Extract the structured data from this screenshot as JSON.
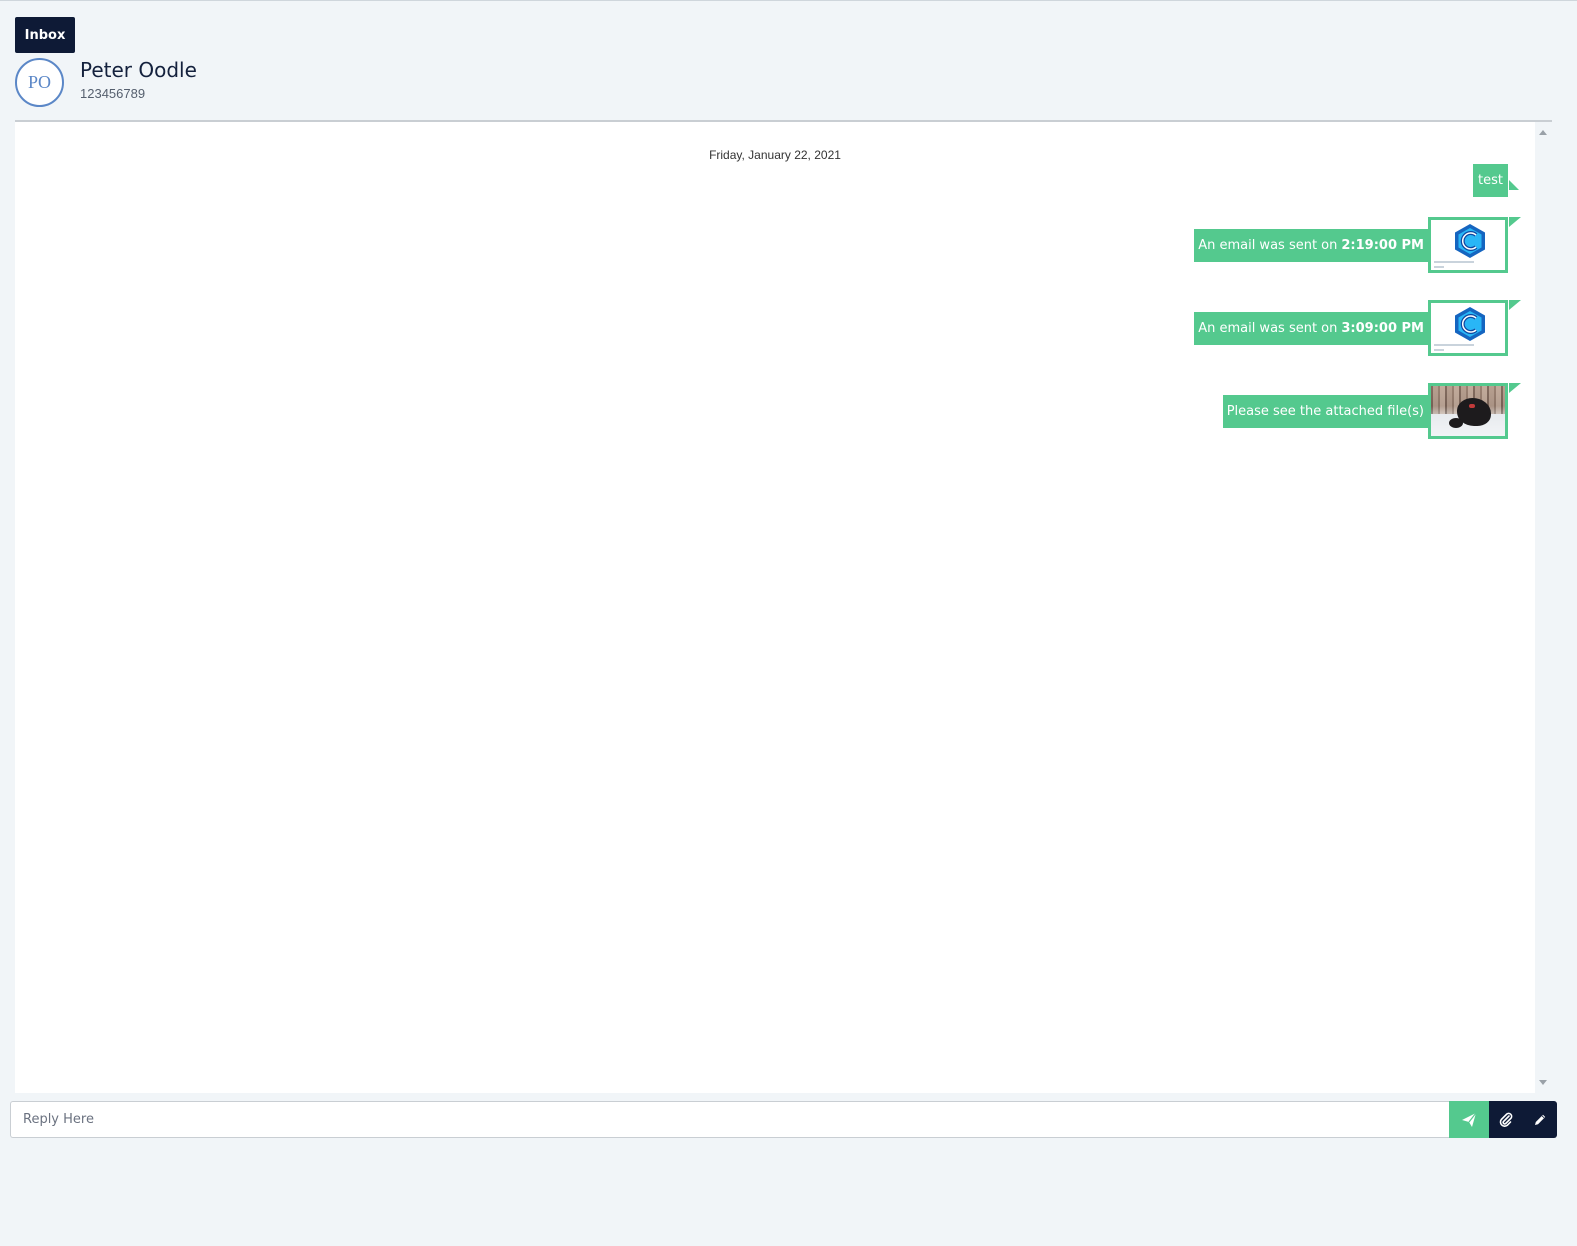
{
  "header": {
    "inbox_label": "Inbox",
    "contact": {
      "initials": "PO",
      "name": "Peter Oodle",
      "phone": "123456789"
    }
  },
  "chat": {
    "date_separator": "Friday, January 22, 2021",
    "messages": [
      {
        "text": "test"
      },
      {
        "prefix": "An email was sent on",
        "time": "2:19:00 PM",
        "attachment": "email-preview"
      },
      {
        "prefix": "An email was sent on",
        "time": "3:09:00 PM",
        "attachment": "email-preview"
      },
      {
        "text": "Please see the attached file(s)",
        "attachment": "photo"
      }
    ]
  },
  "composer": {
    "placeholder": "Reply Here",
    "icons": [
      "send-icon",
      "paperclip-icon",
      "pencil-icon"
    ]
  },
  "colors": {
    "accent_green": "#54c98e",
    "navy": "#0e1a36",
    "avatar_blue": "#5b87c7"
  }
}
